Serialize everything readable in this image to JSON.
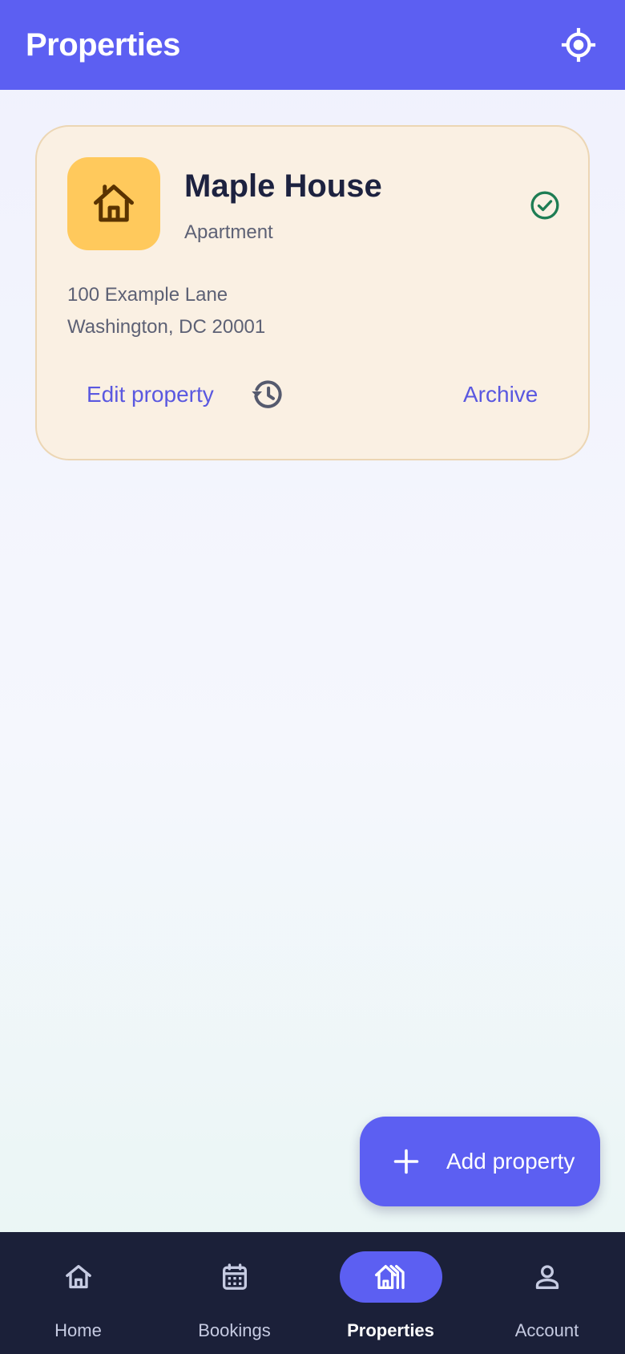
{
  "app_bar": {
    "title": "Properties",
    "action_icon": "my-location-icon",
    "color": "#5c5ff2"
  },
  "property_card": {
    "icon": "house-icon",
    "name": "Maple House",
    "type": "Apartment",
    "status_icon": "check-circle-icon",
    "status_color": "#1e7d54",
    "address_line1": "100 Example Lane",
    "address_line2": "Washington, DC 20001",
    "edit_label": "Edit property",
    "history_icon": "history-icon",
    "archive_label": "Archive"
  },
  "fab": {
    "icon": "plus-icon",
    "label": "Add property"
  },
  "bottom_nav": {
    "items": [
      {
        "label": "Home",
        "icon": "home-icon",
        "active": false
      },
      {
        "label": "Bookings",
        "icon": "calendar-icon",
        "active": false
      },
      {
        "label": "Properties",
        "icon": "properties-icon",
        "active": true
      },
      {
        "label": "Account",
        "icon": "person-icon",
        "active": false
      }
    ]
  }
}
